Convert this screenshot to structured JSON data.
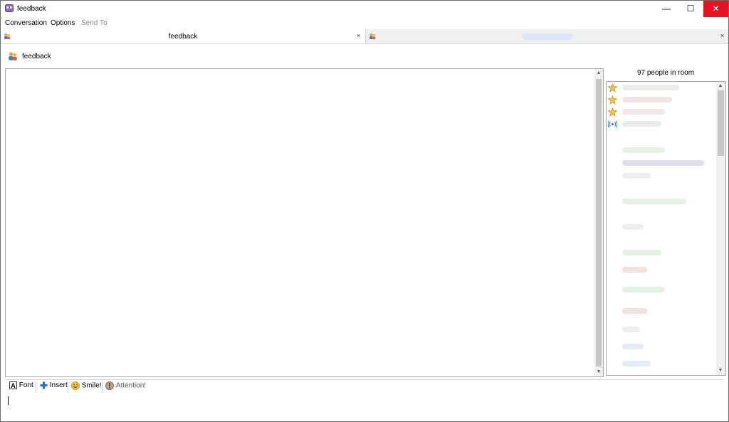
{
  "window": {
    "title": "feedback"
  },
  "title_buttons": {
    "minimize": "—",
    "maximize": "☐",
    "close": "✕"
  },
  "menu": {
    "conversation": "Conversation",
    "options": "Options",
    "send_to": "Send To"
  },
  "tabs": [
    {
      "label": "feedback",
      "close": "×"
    },
    {
      "label": "",
      "close": "×"
    }
  ],
  "conversation": {
    "title": "feedback"
  },
  "room": {
    "people_count": "97 people in room"
  },
  "buddy_icons": [
    "star-icon",
    "star-icon",
    "star-icon",
    "broadcast-icon"
  ],
  "toolbar": {
    "font": "Font",
    "insert": "Insert",
    "smile": "Smile!",
    "attention": "Attention!"
  },
  "colors": {
    "close_button": "#e81123",
    "accent_blue": "#2a6cd6",
    "disabled_text": "#8a8a8a"
  }
}
